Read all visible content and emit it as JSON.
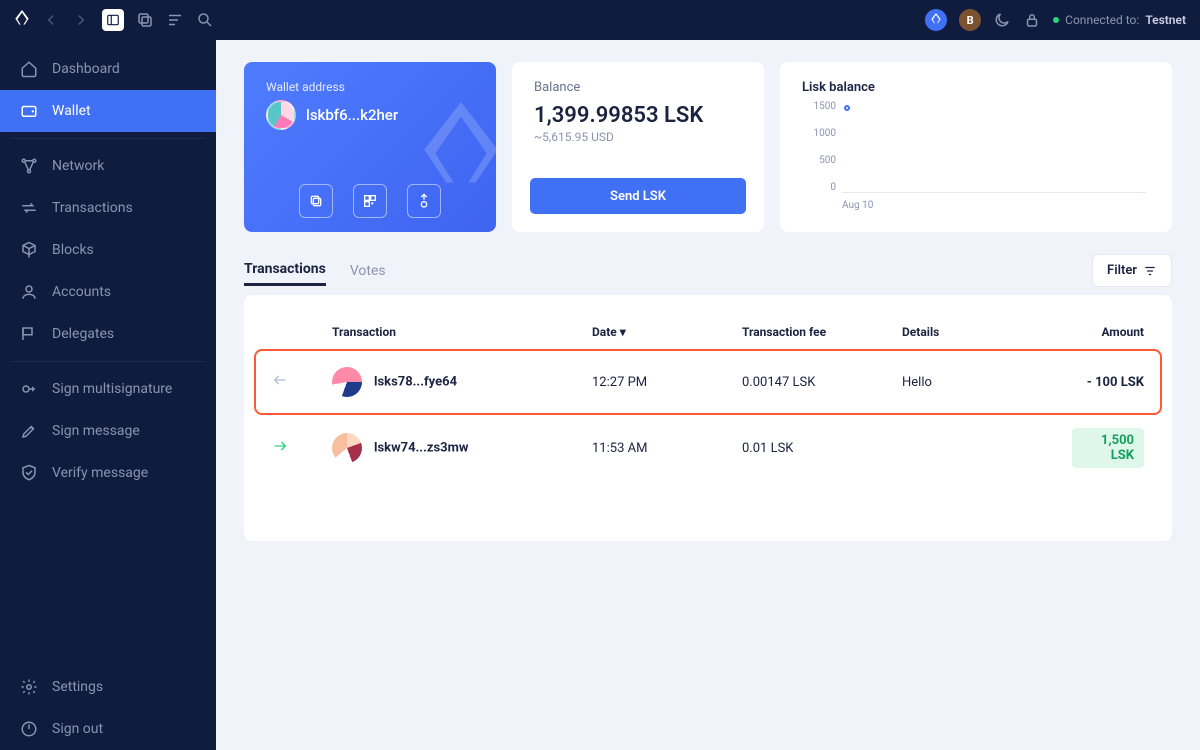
{
  "topbar": {
    "connected_label": "Connected to:",
    "connected_value": "Testnet"
  },
  "sidebar": {
    "items": [
      {
        "label": "Dashboard"
      },
      {
        "label": "Wallet"
      },
      {
        "label": "Network"
      },
      {
        "label": "Transactions"
      },
      {
        "label": "Blocks"
      },
      {
        "label": "Accounts"
      },
      {
        "label": "Delegates"
      },
      {
        "label": "Sign multisignature"
      },
      {
        "label": "Sign message"
      },
      {
        "label": "Verify message"
      }
    ],
    "footer": [
      {
        "label": "Settings"
      },
      {
        "label": "Sign out"
      }
    ]
  },
  "address_card": {
    "label": "Wallet address",
    "address": "lskbf6...k2her"
  },
  "balance_card": {
    "label": "Balance",
    "amount": "1,399.99853 LSK",
    "usd": "~5,615.95 USD",
    "send_label": "Send LSK"
  },
  "chart_card": {
    "label": "Lisk balance"
  },
  "chart_data": {
    "type": "line",
    "x_ticks": [
      "Aug 10"
    ],
    "y_ticks": [
      "1500",
      "1000",
      "500",
      "0"
    ],
    "ylim": [
      0,
      1500
    ],
    "series": [
      {
        "name": "Lisk balance",
        "points": [
          {
            "x": "Aug 10",
            "y": 1400
          }
        ]
      }
    ]
  },
  "tabs": {
    "transactions": "Transactions",
    "votes": "Votes"
  },
  "filter_label": "Filter",
  "table": {
    "headers": {
      "transaction": "Transaction",
      "date": "Date",
      "fee": "Transaction fee",
      "details": "Details",
      "amount": "Amount"
    },
    "rows": [
      {
        "direction": "out",
        "who": "lsks78...fye64",
        "date": "12:27 PM",
        "fee": "0.00147 LSK",
        "details": "Hello",
        "amount": "- 100 LSK",
        "highlighted": true,
        "positive": false
      },
      {
        "direction": "in",
        "who": "lskw74...zs3mw",
        "date": "11:53 AM",
        "fee": "0.01 LSK",
        "details": "",
        "amount": "1,500 LSK",
        "highlighted": false,
        "positive": true
      }
    ]
  }
}
